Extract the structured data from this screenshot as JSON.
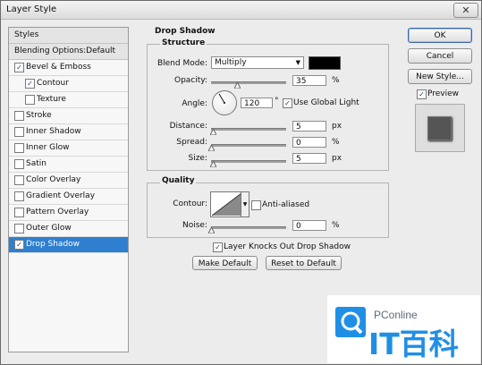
{
  "window": {
    "title": "Layer Style",
    "close_glyph": "✕"
  },
  "sidebar": {
    "items": [
      {
        "label": "Styles",
        "checkbox": false,
        "checked": false,
        "selected": false,
        "indent": false,
        "head": true
      },
      {
        "label": "Blending Options:Default",
        "checkbox": false,
        "checked": false,
        "selected": false,
        "indent": false,
        "head": true
      },
      {
        "label": "Bevel & Emboss",
        "checkbox": true,
        "checked": true,
        "selected": false,
        "indent": false
      },
      {
        "label": "Contour",
        "checkbox": true,
        "checked": true,
        "selected": false,
        "indent": true
      },
      {
        "label": "Texture",
        "checkbox": true,
        "checked": false,
        "selected": false,
        "indent": true
      },
      {
        "label": "Stroke",
        "checkbox": true,
        "checked": false,
        "selected": false,
        "indent": false
      },
      {
        "label": "Inner Shadow",
        "checkbox": true,
        "checked": false,
        "selected": false,
        "indent": false
      },
      {
        "label": "Inner Glow",
        "checkbox": true,
        "checked": false,
        "selected": false,
        "indent": false
      },
      {
        "label": "Satin",
        "checkbox": true,
        "checked": false,
        "selected": false,
        "indent": false
      },
      {
        "label": "Color Overlay",
        "checkbox": true,
        "checked": false,
        "selected": false,
        "indent": false
      },
      {
        "label": "Gradient Overlay",
        "checkbox": true,
        "checked": false,
        "selected": false,
        "indent": false
      },
      {
        "label": "Pattern Overlay",
        "checkbox": true,
        "checked": false,
        "selected": false,
        "indent": false
      },
      {
        "label": "Outer Glow",
        "checkbox": true,
        "checked": false,
        "selected": false,
        "indent": false
      },
      {
        "label": "Drop Shadow",
        "checkbox": true,
        "checked": true,
        "selected": true,
        "indent": false
      }
    ]
  },
  "drop_shadow": {
    "section_title": "Drop Shadow",
    "structure": {
      "title": "Structure",
      "blend_mode_label": "Blend Mode:",
      "blend_mode_value": "Multiply",
      "shadow_color": "#000000",
      "opacity_label": "Opacity:",
      "opacity_value": "35",
      "opacity_unit": "%",
      "opacity_level": 0.35,
      "angle_label": "Angle:",
      "angle_value": "120",
      "angle_unit": "°",
      "use_global_light_label": "Use Global Light",
      "use_global_light_checked": true,
      "distance_label": "Distance:",
      "distance_value": "5",
      "distance_unit": "px",
      "distance_level": 0.02,
      "spread_label": "Spread:",
      "spread_value": "0",
      "spread_unit": "%",
      "spread_level": 0,
      "size_label": "Size:",
      "size_value": "5",
      "size_unit": "px",
      "size_level": 0.02
    },
    "quality": {
      "title": "Quality",
      "contour_label": "Contour:",
      "anti_aliased_label": "Anti-aliased",
      "anti_aliased_checked": false,
      "noise_label": "Noise:",
      "noise_value": "0",
      "noise_unit": "%",
      "noise_level": 0
    },
    "layer_knocks_out_label": "Layer Knocks Out Drop Shadow",
    "layer_knocks_out_checked": true,
    "make_default_label": "Make Default",
    "reset_to_default_label": "Reset to Default"
  },
  "buttons": {
    "ok_label": "OK",
    "cancel_label": "Cancel",
    "new_style_label": "New Style...",
    "preview_label": "Preview",
    "preview_checked": true
  },
  "watermark": {
    "brand": "PConline",
    "chinese": "IT百科",
    "color": "#1f8fe6"
  }
}
